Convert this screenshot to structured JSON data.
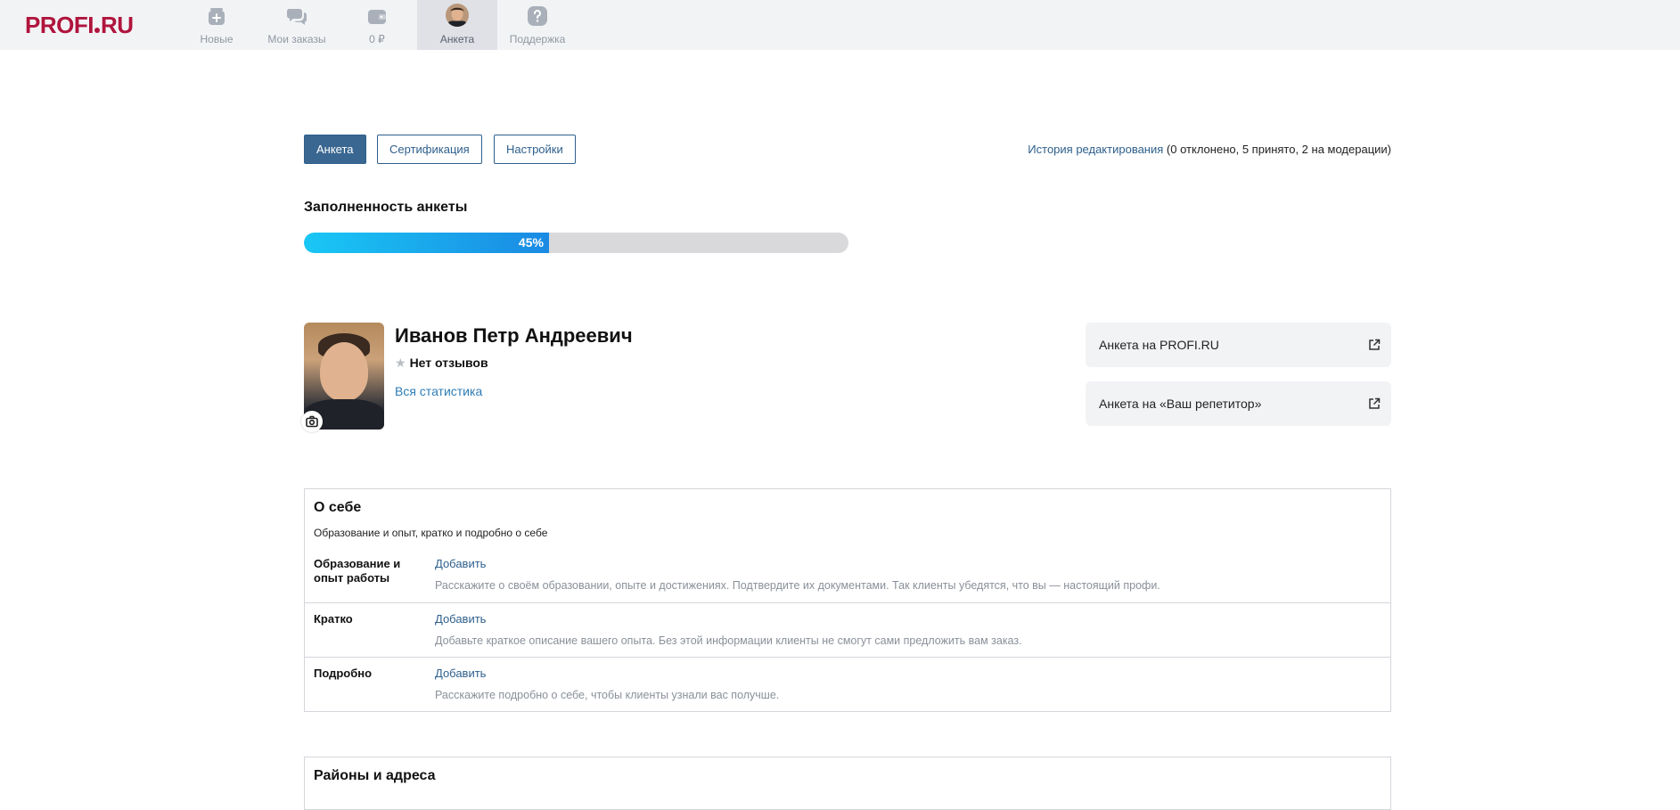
{
  "nav": {
    "logo_left": "PROFI",
    "logo_right": "RU",
    "items": [
      {
        "label": "Новые",
        "icon": "plus-stack-icon"
      },
      {
        "label": "Мои заказы",
        "icon": "chat-bubbles-icon"
      },
      {
        "label": "0 ₽",
        "icon": "wallet-icon"
      },
      {
        "label": "Анкета",
        "icon": "avatar-icon",
        "active": true
      },
      {
        "label": "Поддержка",
        "icon": "question-icon"
      }
    ]
  },
  "tabs": [
    "Анкета",
    "Сертификация",
    "Настройки"
  ],
  "history": {
    "link": "История редактирования",
    "summary": "(0 отклонено, 5 принято, 2 на модерации)"
  },
  "progress": {
    "title": "Заполненность анкеты",
    "percent_label": "45%",
    "value": 0.45
  },
  "profile": {
    "name": "Иванов Петр Андреевич",
    "reviews": "Нет отзывов",
    "stats_link": "Вся статистика"
  },
  "external_links": [
    {
      "label": "Анкета на PROFI.RU"
    },
    {
      "label": "Анкета на «Ваш репетитор»"
    }
  ],
  "about": {
    "title": "О себе",
    "subtitle": "Образование и опыт, кратко и подробно о себе",
    "rows": [
      {
        "label": "Образование и опыт работы",
        "action": "Добавить",
        "hint": "Расскажите о своём образовании, опыте и достижениях. Подтвердите их документами. Так клиенты убедятся, что вы — настоящий профи."
      },
      {
        "label": "Кратко",
        "action": "Добавить",
        "hint": "Добавьте краткое описание вашего опыта. Без этой информации клиенты не смогут сами предложить вам заказ."
      },
      {
        "label": "Подробно",
        "action": "Добавить",
        "hint": "Расскажите подробно о себе, чтобы клиенты узнали вас получше."
      }
    ]
  },
  "districts": {
    "title": "Районы и адреса"
  },
  "colors": {
    "brand": "#b0143c",
    "link": "#2e5f8c",
    "accent_tab": "#3a6791",
    "progress_start": "#19c7f5",
    "progress_end": "#1a8ae3"
  }
}
